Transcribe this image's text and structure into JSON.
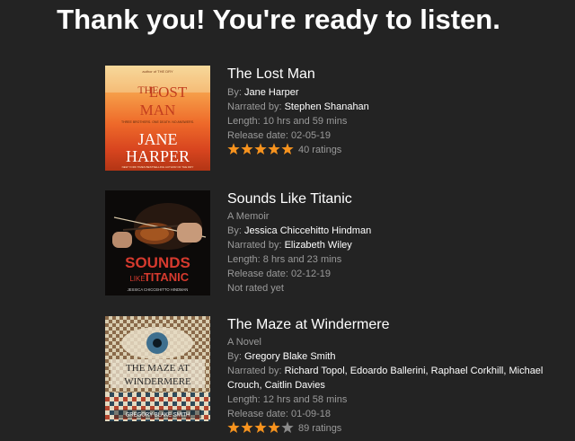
{
  "heading": "Thank you! You're ready to listen.",
  "colors": {
    "background": "#232323",
    "star_filled": "#f7931e",
    "star_empty": "#8a8a8a",
    "muted_text": "#9a9a9a"
  },
  "books": [
    {
      "title": "The Lost Man",
      "by_label": "By:",
      "author": "Jane Harper",
      "narrated_label": "Narrated by:",
      "narrator": "Stephen Shanahan",
      "length_label": "Length:",
      "length": "10 hrs and 59 mins",
      "release_label": "Release date:",
      "release_date": "02-05-19",
      "rating_stars": 5,
      "ratings_text": "40 ratings",
      "cover": {
        "top_small": "author of THE DRY",
        "title_word1": "THE",
        "title_word2": "LOST",
        "title_word3": "MAN",
        "tagline": "THREE BROTHERS. ONE DEATH. NO ANSWERS.",
        "author_word1": "JANE",
        "author_word2": "HARPER",
        "bottom_small": "NEW YORK TIMES BESTSELLING AUTHOR OF THE DRY",
        "icon": "sunset-outback-cover"
      }
    },
    {
      "title": "Sounds Like Titanic",
      "subtitle": "A Memoir",
      "by_label": "By:",
      "author": "Jessica Chiccehitto Hindman",
      "narrated_label": "Narrated by:",
      "narrator": "Elizabeth Wiley",
      "length_label": "Length:",
      "length": "8 hrs and 23 mins",
      "release_label": "Release date:",
      "release_date": "02-12-19",
      "not_rated": "Not rated yet",
      "cover": {
        "title_word1": "SOUNDS",
        "title_word2": "LIKE",
        "title_word3": "TITANIC",
        "author_line": "JESSICA CHICCEHITTO HINDMAN",
        "icon": "violin-cover"
      }
    },
    {
      "title": "The Maze at Windermere",
      "subtitle": "A Novel",
      "by_label": "By:",
      "author": "Gregory Blake Smith",
      "narrated_label": "Narrated by:",
      "narrators": "Richard Topol, Edoardo Ballerini, Raphael Corkhill, Michael Crouch, Caitlin Davies",
      "length_label": "Length:",
      "length": "12 hrs and 58 mins",
      "release_label": "Release date:",
      "release_date": "01-09-18",
      "rating_stars": 4,
      "ratings_text": "89 ratings",
      "cover": {
        "title_line1": "THE MAZE AT",
        "title_line2": "WINDERMERE",
        "author_line": "GREGORY BLAKE SMITH",
        "icon": "eye-maze-cover"
      }
    }
  ]
}
